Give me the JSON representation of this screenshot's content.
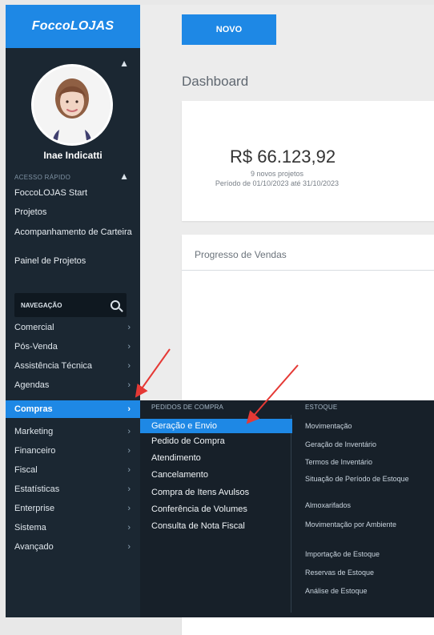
{
  "app": {
    "brand": "FoccoLOJAS"
  },
  "user": {
    "name": "Inae Indicatti"
  },
  "quick_access": {
    "title": "ACESSO RÁPIDO",
    "items": [
      "FoccoLOJAS Start",
      "Projetos",
      "Acompanhamento de Carteira",
      "Painel de Projetos"
    ]
  },
  "navigation": {
    "label": "NAVEGAÇÃO",
    "items": [
      {
        "label": "Comercial"
      },
      {
        "label": "Pós-Venda"
      },
      {
        "label": "Assistência Técnica"
      },
      {
        "label": "Agendas"
      },
      {
        "label": "Compras"
      },
      {
        "label": "Marketing"
      },
      {
        "label": "Financeiro"
      },
      {
        "label": "Fiscal"
      },
      {
        "label": "Estatísticas"
      },
      {
        "label": "Enterprise"
      },
      {
        "label": "Sistema"
      },
      {
        "label": "Avançado"
      }
    ]
  },
  "main": {
    "new_button": "NOVO",
    "dashboard_title": "Dashboard",
    "summary": {
      "value": "R$ 66.123,92",
      "projects": "9 novos projetos",
      "period": "Período de 01/10/2023 até 31/10/2023"
    },
    "sales_progress_title": "Progresso de Vendas"
  },
  "flyout": {
    "purchase_orders_title": "PEDIDOS DE COMPRA",
    "purchase_orders": [
      "Geração e Envio",
      "Pedido de Compra",
      "Atendimento",
      "Cancelamento",
      "Compra de Itens Avulsos",
      "Conferência de Volumes",
      "Consulta de Nota Fiscal"
    ],
    "stock_title": "ESTOQUE",
    "stock": [
      "Movimentação",
      "Geração de Inventário",
      "Termos de Inventário",
      "Situação de Período de Estoque",
      "Almoxarifados",
      "Movimentação por Ambiente",
      "Importação de Estoque",
      "Reservas de Estoque",
      "Análise de Estoque"
    ]
  },
  "colors": {
    "accent": "#1e88e5",
    "sidebar": "#1b2732",
    "flyout": "#172029",
    "arrow": "#e53935"
  },
  "icons": {
    "search": "search-icon",
    "chevron_right": "chevron-right-icon",
    "collapse_up": "chevron-up-icon",
    "avatar": "avatar-image"
  }
}
